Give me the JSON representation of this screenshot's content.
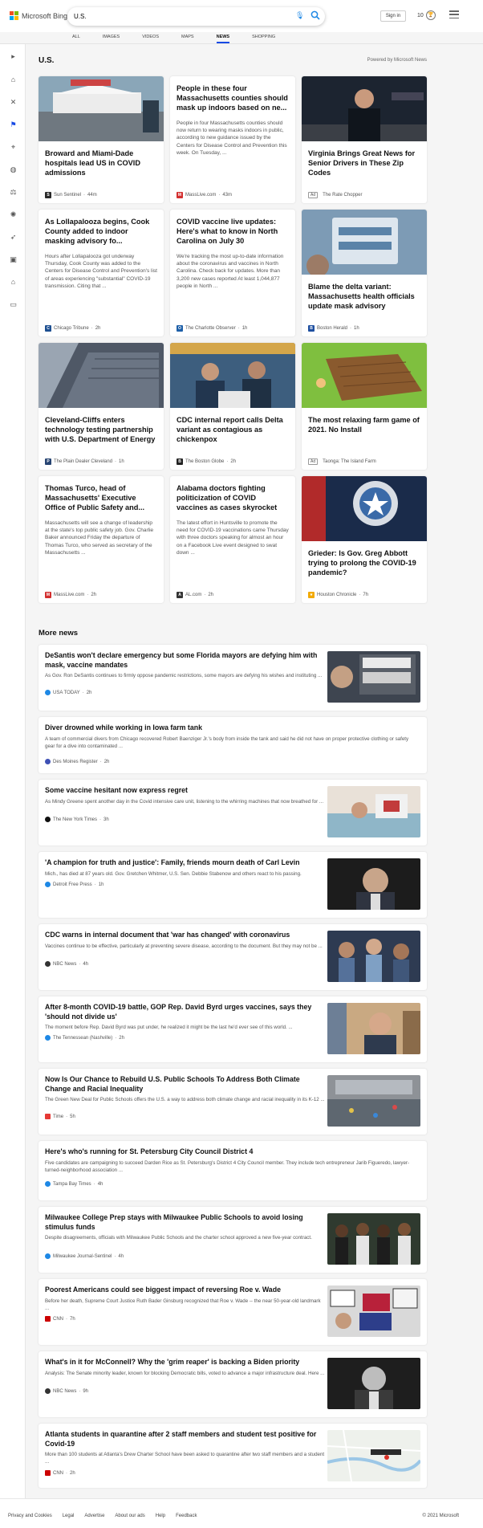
{
  "header": {
    "logo_text": "Microsoft Bing",
    "search_value": "U.S.",
    "sign_in": "Sign in",
    "rewards_count": "10"
  },
  "tabs": [
    {
      "label": "ALL"
    },
    {
      "label": "IMAGES"
    },
    {
      "label": "VIDEOS"
    },
    {
      "label": "MAPS"
    },
    {
      "label": "NEWS",
      "active": true
    },
    {
      "label": "SHOPPING"
    }
  ],
  "page": {
    "title": "U.S.",
    "powered_by": "Powered by Microsoft News",
    "more_news": "More news"
  },
  "cards": [
    {
      "title": "Broward and Miami-Dade hospitals lead US in COVID admissions",
      "source": "Sun Sentinel",
      "time": "44m",
      "logo_color": "#2a2a2a"
    },
    {
      "title": "People in these four Massachusetts counties should mask up indoors based on ne...",
      "snippet": "People in four Massachusetts counties should now return to wearing masks indoors in public, according to new guidance issued by the Centers for Disease Control and Prevention this week. On Tuesday, ...",
      "source": "MassLive.com",
      "time": "43m",
      "logo_color": "#d32f2f"
    },
    {
      "title": "Virginia Brings Great News for Senior Drivers in These Zip Codes",
      "ad_label": "Ad",
      "source": "The Rate Chopper"
    },
    {
      "title": "As Lollapalooza begins, Cook County added to indoor masking advisory fo...",
      "snippet": "Hours after Lollapalooza got underway Thursday, Cook County was added to the Centers for Disease Control and Prevention's list of areas experiencing \"substantial\" COVID-19 transmission. Citing that ...",
      "source": "Chicago Tribune",
      "time": "2h",
      "logo_color": "#1d4f91"
    },
    {
      "title": "COVID vaccine live updates: Here's what to know in North Carolina on July 30",
      "snippet": "We're tracking the most up-to-date information about the coronavirus and vaccines in North Carolina. Check back for updates. More than 3,200 new cases reported At least 1,044,877 people in North ...",
      "source": "The Charlotte Observer",
      "time": "1h",
      "logo_color": "#1d5fa8"
    },
    {
      "title": "Blame the delta variant: Massachusetts health officials update mask advisory",
      "source": "Boston Herald",
      "time": "1h",
      "logo_color": "#1e4fa0"
    },
    {
      "title": "Cleveland-Cliffs enters technology testing partnership with U.S. Department of Energy",
      "source": "The Plain Dealer Cleveland",
      "time": "1h",
      "logo_color": "#274472"
    },
    {
      "title": "CDC internal report calls Delta variant as contagious as chickenpox",
      "source": "The Boston Globe",
      "time": "2h",
      "logo_color": "#222"
    },
    {
      "title": "The most relaxing farm game of 2021. No Install",
      "ad_label": "Ad",
      "source": "Taonga: The Island Farm"
    },
    {
      "title": "Thomas Turco, head of Massachusetts' Executive Office of Public Safety and...",
      "snippet": "Massachusetts will see a change of leadership at the state's top public safety job. Gov. Charlie Baker announced Friday the departure of Thomas Turco, who served as secretary of the Massachusetts ...",
      "source": "MassLive.com",
      "time": "2h",
      "logo_color": "#d32f2f"
    },
    {
      "title": "Alabama doctors fighting politicization of COVID vaccines as cases skyrocket",
      "snippet": "The latest effort in Huntsville to promote the need for COVID-19 vaccinations came Thursday with three doctors speaking for almost an hour on a Facebook Live event designed to swat down ...",
      "source": "AL.com",
      "time": "2h",
      "logo_color": "#333"
    },
    {
      "title": "Grieder: Is Gov. Greg Abbott trying to prolong the COVID-19 pandemic?",
      "source": "Houston Chronicle",
      "time": "7h",
      "logo_color": "#f2a900"
    }
  ],
  "more": [
    {
      "title": "DeSantis won't declare emergency but some Florida mayors are defying him with mask, vaccine mandates",
      "snippet": "As Gov. Ron DeSantis continues to firmly oppose pandemic restrictions, some mayors are defying his wishes and instituting ...",
      "source": "USA TODAY",
      "time": "2h",
      "logo_color": "#1e88e5"
    },
    {
      "title": "Diver drowned while working in Iowa farm tank",
      "snippet": "A team of commercial divers from Chicago recovered Robert Baenziger Jr.'s body from inside the tank and said he did not have on proper protective clothing or safety gear for a dive into contaminated ...",
      "source": "Des Moines Register",
      "time": "2h",
      "logo_color": "#3f51b5"
    },
    {
      "title": "Some vaccine hesitant now express regret",
      "snippet": "As Mindy Greene spent another day in the Covid intensive care unit, listening to the whirring machines that now breathed for ...",
      "source": "The New York Times",
      "time": "3h",
      "logo_color": "#111"
    },
    {
      "title": "'A champion for truth and justice': Family, friends mourn death of Carl Levin",
      "snippet": "Mich., has died at 87 years old. Gov. Gretchen Whitmer, U.S. Sen. Debbie Stabenow and others react to his passing.",
      "source": "Detroit Free Press",
      "time": "1h",
      "logo_color": "#1e88e5"
    },
    {
      "title": "CDC warns in internal document that 'war has changed' with coronavirus",
      "snippet": "Vaccines continue to be effective, particularly at preventing severe disease, according to the document. But they may not be ...",
      "source": "NBC News",
      "time": "4h",
      "logo_color": "#333"
    },
    {
      "title": "After 8-month COVID-19 battle, GOP Rep. David Byrd urges vaccines, says they 'should not divide us'",
      "snippet": "The moment before Rep. David Byrd was put under, he realized it might be the last he'd ever see of this world. ...",
      "source": "The Tennessean (Nashville)",
      "time": "2h",
      "logo_color": "#1e88e5"
    },
    {
      "title": "Now Is Our Chance to Rebuild U.S. Public Schools To Address Both Climate Change and Racial Inequality",
      "snippet": "The Green New Deal for Public Schools offers the U.S. a way to address both climate change and racial inequality in its K-12 ...",
      "source": "Time",
      "time": "5h",
      "logo_color": "#e53935"
    },
    {
      "title": "Here's who's running for St. Petersburg City Council District 4",
      "snippet": "Five candidates are campaigning to succeed Darden Rice as St. Petersburg's District 4 City Council member. They include tech entrepreneur Jarib Figueredo, lawyer-turned-neighborhood association ...",
      "source": "Tampa Bay Times",
      "time": "4h",
      "logo_color": "#1e88e5"
    },
    {
      "title": "Milwaukee College Prep stays with Milwaukee Public Schools to avoid losing stimulus funds",
      "snippet": "Despite disagreements, officials with Milwaukee Public Schools and the charter school approved a new five-year contract.",
      "source": "Milwaukee Journal-Sentinel",
      "time": "4h",
      "logo_color": "#1e88e5"
    },
    {
      "title": "Poorest Americans could see biggest impact of reversing Roe v. Wade",
      "snippet": "Before her death, Supreme Court Justice Ruth Bader Ginsburg recognized that Roe v. Wade -- the near 50-year-old landmark ...",
      "source": "CNN",
      "time": "7h",
      "logo_color": "#cc0000"
    },
    {
      "title": "What's in it for McConnell? Why the 'grim reaper' is backing a Biden priority",
      "snippet": "Analysis: The Senate minority leader, known for blocking Democratic bills, voted to advance a major infrastructure deal. Here ...",
      "source": "NBC News",
      "time": "9h",
      "logo_color": "#333"
    },
    {
      "title": "Atlanta students in quarantine after 2 staff members and student test positive for Covid-19",
      "snippet": "More than 100 students at Atlanta's Drew Charter School have been asked to quarantine after two staff members and a student ...",
      "source": "CNN",
      "time": "2h",
      "logo_color": "#cc0000"
    }
  ],
  "footer": {
    "links": [
      "Privacy and Cookies",
      "Legal",
      "Advertise",
      "About our ads",
      "Help",
      "Feedback"
    ],
    "copyright": "© 2021 Microsoft"
  },
  "icons": {
    "rail": [
      "expand-icon",
      "home-icon",
      "crossed-swords-icon",
      "flag-icon",
      "map-pin-icon",
      "globe-icon",
      "scales-icon",
      "virus-icon",
      "rocket-icon",
      "film-icon",
      "bank-icon",
      "wallet-icon"
    ]
  },
  "colors": {
    "accent": "#174ae4",
    "search_blue": "#1e88e5"
  }
}
